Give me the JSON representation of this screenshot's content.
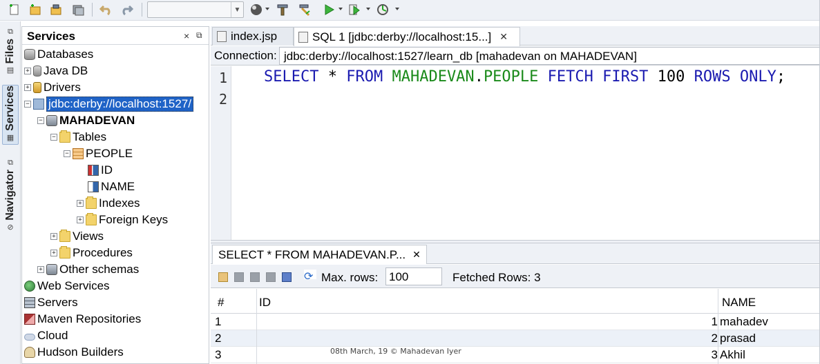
{
  "toolbar": {
    "config_value": ""
  },
  "side_tabs": {
    "files": "Files",
    "services": "Services",
    "navigator": "Navigator"
  },
  "services_panel": {
    "title": "Services",
    "close": "×",
    "restore": "⧉"
  },
  "tree": {
    "databases": "Databases",
    "java_db": "Java DB",
    "drivers": "Drivers",
    "connection": "jdbc:derby://localhost:1527/",
    "schema": "MAHADEVAN",
    "tables": "Tables",
    "people": "PEOPLE",
    "col_id": "ID",
    "col_name": "NAME",
    "indexes": "Indexes",
    "foreign_keys": "Foreign Keys",
    "views": "Views",
    "procedures": "Procedures",
    "other_schemas": "Other schemas",
    "web_services": "Web Services",
    "servers": "Servers",
    "maven_repositories": "Maven Repositories",
    "cloud": "Cloud",
    "hudson_builders": "Hudson Builders"
  },
  "editor_tabs": [
    {
      "label": "index.jsp"
    },
    {
      "label": "SQL 1 [jdbc:derby://localhost:15...]"
    }
  ],
  "connection": {
    "label": "Connection:",
    "value": "jdbc:derby://localhost:1527/learn_db [mahadevan on MAHADEVAN]"
  },
  "sql": {
    "line_numbers": [
      "1",
      "2"
    ],
    "tokens": {
      "select": "SELECT",
      "star": " * ",
      "from": "FROM",
      "schema": "MAHADEVAN",
      "dot": ".",
      "table": "PEOPLE",
      "fetch": "FETCH",
      "first": "FIRST",
      "count": "100",
      "rows": "ROWS",
      "only": "ONLY",
      "semicolon": ";"
    }
  },
  "results": {
    "tab_label": "SELECT * FROM MAHADEVAN.P...",
    "max_rows_label": "Max. rows:",
    "max_rows_value": "100",
    "fetched": "Fetched Rows: 3",
    "headers": {
      "num": "#",
      "id": "ID",
      "name": "NAME"
    },
    "rows": [
      {
        "num": "1",
        "id": "1",
        "name": "mahadev"
      },
      {
        "num": "2",
        "id": "2",
        "name": "prasad"
      },
      {
        "num": "3",
        "id": "3",
        "name": "Akhil"
      }
    ]
  },
  "watermark": "08th March, 19 © Mahadevan Iyer"
}
